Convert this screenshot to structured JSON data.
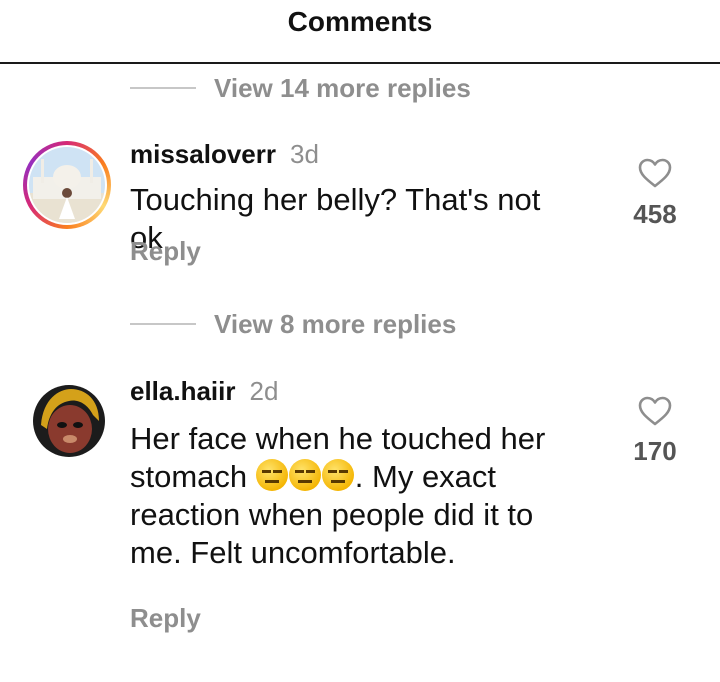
{
  "header": {
    "title": "Comments"
  },
  "thread1": {
    "view_more_label": "View 14 more replies"
  },
  "comment1": {
    "username": "missaloverr",
    "time": "3d",
    "text": "Touching her belly? That's not ok",
    "reply_label": "Reply",
    "likes": "458"
  },
  "thread2": {
    "view_more_label": "View 8 more replies"
  },
  "comment2": {
    "username": "ella.haiir",
    "time": "2d",
    "text_part1": "Her face when he touched her stomach ",
    "emoji_icon": "expressionless-face-icon",
    "text_part2": ". My exact reaction when people did it to me. Felt uncomfortable.",
    "reply_label": "Reply",
    "likes": "170"
  },
  "colors": {
    "muted": "#8e8e8e",
    "story_ring": "#d62976"
  }
}
